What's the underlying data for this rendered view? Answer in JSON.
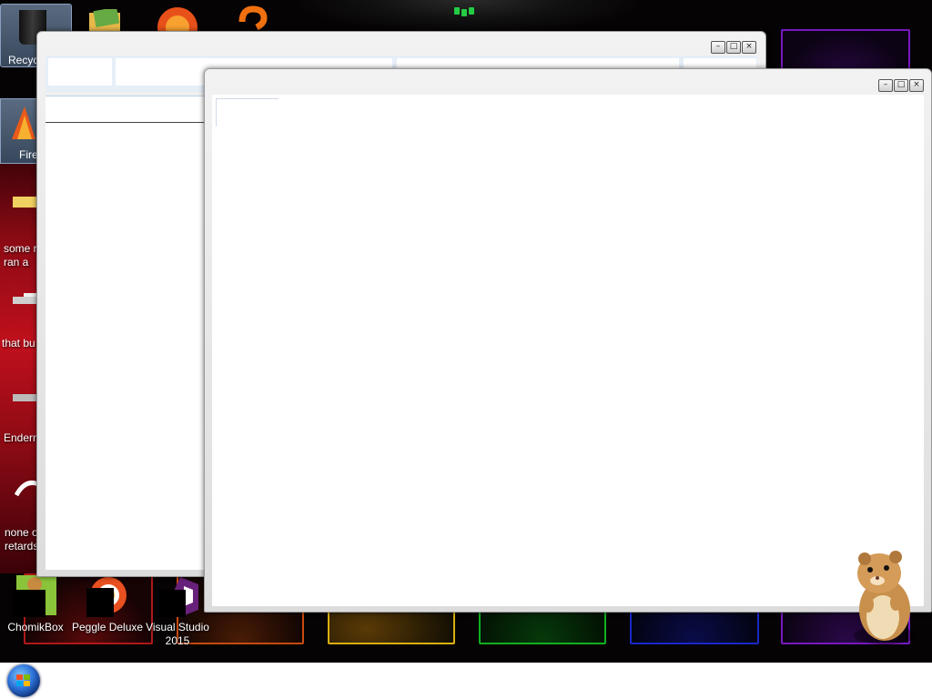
{
  "desktop": {
    "icons": [
      {
        "label": "Recyc"
      },
      {
        "label": "Fire"
      },
      {
        "label": "some r\nran a"
      },
      {
        "label": "that bu"
      },
      {
        "label": "Enderm"
      },
      {
        "label": "none o\nretards"
      },
      {
        "label": "ChomikBox"
      },
      {
        "label": "Peggle Deluxe"
      },
      {
        "label": "Visual Studio\n2015"
      }
    ]
  },
  "windows": {
    "back": {
      "minimize": "–",
      "maximize": "□",
      "close": "×"
    },
    "front": {
      "minimize": "–",
      "maximize": "□",
      "close": "×"
    }
  },
  "colors": {
    "taskbar": "#ffffff",
    "desktop": "#060304",
    "window_frame": "#dcdcdc",
    "window_client": "#ffffff"
  },
  "icons": [
    "recycle-bin-icon",
    "firefox-icon",
    "folder-icon",
    "drive-icon",
    "peggle-icon",
    "chomikbox-icon",
    "visual-studio-icon",
    "start-orb-icon",
    "hamster-mascot-icon"
  ]
}
